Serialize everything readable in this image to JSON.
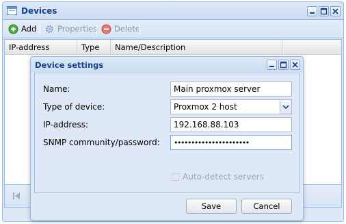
{
  "window": {
    "title": "Devices",
    "icon": "grid-window-icon"
  },
  "toolbar": {
    "add_label": "Add",
    "properties_label": "Properties",
    "delete_label": "Delete"
  },
  "grid": {
    "columns": [
      "IP-address",
      "Type",
      "Name/Description"
    ],
    "rows": []
  },
  "dialog": {
    "title": "Device settings",
    "fields": {
      "name_label": "Name:",
      "name_value": "Main proxmox server",
      "type_label": "Type of device:",
      "type_value": "Proxmox 2 host",
      "ip_label": "IP-address:",
      "ip_value": "192.168.88.103",
      "snmp_label": "SNMP community/password:",
      "snmp_value": "••••••••••••••••••••••",
      "autodetect_label": "Auto-detect servers",
      "autodetect_checked": false,
      "autodetect_disabled": true
    },
    "save_label": "Save",
    "cancel_label": "Cancel"
  },
  "colors": {
    "header_text": "#15428b",
    "panel_bg": "#dfe8f6",
    "border": "#99bbe8",
    "add_icon": "#3a9a2e",
    "delete_icon": "#d8564a"
  }
}
